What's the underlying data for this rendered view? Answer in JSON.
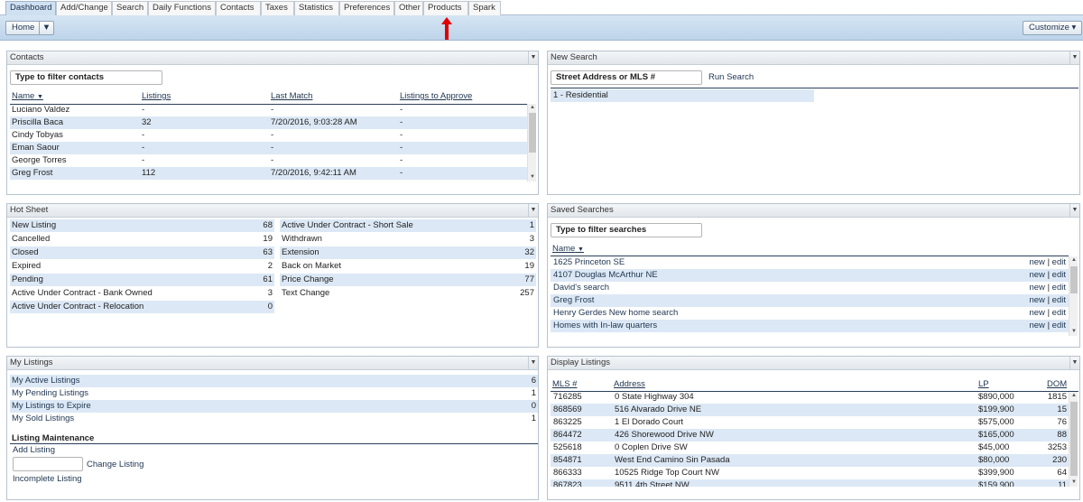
{
  "tabs": [
    "Dashboard",
    "Add/Change",
    "Search",
    "Daily Functions",
    "Contacts",
    "Taxes",
    "Statistics",
    "Preferences",
    "Other",
    "Products",
    "Spark"
  ],
  "active_tab": "Dashboard",
  "toolbar": {
    "home_label": "Home",
    "home_dropdown_icon": "chevron-down-icon",
    "customize_label": "Customize"
  },
  "contacts": {
    "title": "Contacts",
    "filter_placeholder": "Type to filter contacts",
    "headers": {
      "name": "Name",
      "listings": "Listings",
      "last_match": "Last Match",
      "to_approve": "Listings to Approve"
    },
    "rows": [
      {
        "name": "Luciano Valdez",
        "listings": "-",
        "last_match": "-",
        "to_approve": "-"
      },
      {
        "name": "Priscilla Baca",
        "listings": "32",
        "last_match": "7/20/2016, 9:03:28 AM",
        "to_approve": "-"
      },
      {
        "name": "Cindy Tobyas",
        "listings": "-",
        "last_match": "-",
        "to_approve": "-"
      },
      {
        "name": "Eman Saour",
        "listings": "-",
        "last_match": "-",
        "to_approve": "-"
      },
      {
        "name": "George Torres",
        "listings": "-",
        "last_match": "-",
        "to_approve": "-"
      },
      {
        "name": "Greg Frost",
        "listings": "112",
        "last_match": "7/20/2016, 9:42:11 AM",
        "to_approve": "-"
      }
    ]
  },
  "new_search": {
    "title": "New Search",
    "input_placeholder": "Street Address or MLS #",
    "run_label": "Run Search",
    "options": [
      "1 - Residential"
    ]
  },
  "hot_sheet": {
    "title": "Hot Sheet",
    "left": [
      {
        "label": "New Listing",
        "count": "68"
      },
      {
        "label": "Cancelled",
        "count": "19"
      },
      {
        "label": "Closed",
        "count": "63"
      },
      {
        "label": "Expired",
        "count": "2"
      },
      {
        "label": "Pending",
        "count": "61"
      },
      {
        "label": "Active Under Contract - Bank Owned",
        "count": "3"
      },
      {
        "label": "Active Under Contract - Relocation",
        "count": "0"
      }
    ],
    "right": [
      {
        "label": "Active Under Contract - Short Sale",
        "count": "1"
      },
      {
        "label": "Withdrawn",
        "count": "3"
      },
      {
        "label": "Extension",
        "count": "32"
      },
      {
        "label": "Back on Market",
        "count": "19"
      },
      {
        "label": "Price Change",
        "count": "77"
      },
      {
        "label": "Text Change",
        "count": "257"
      }
    ]
  },
  "saved_searches": {
    "title": "Saved Searches",
    "filter_placeholder": "Type to filter searches",
    "name_header": "Name",
    "new_label": "new",
    "sep": "|",
    "edit_label": "edit",
    "rows": [
      "1625 Princeton SE",
      "4107 Douglas McArthur NE",
      "David's search",
      "Greg Frost",
      "Henry Gerdes New home search",
      "Homes with In-law quarters"
    ]
  },
  "my_listings": {
    "title": "My Listings",
    "items": [
      {
        "label": "My Active Listings",
        "count": "6"
      },
      {
        "label": "My Pending Listings",
        "count": "1"
      },
      {
        "label": "My Listings to Expire",
        "count": "0"
      },
      {
        "label": "My Sold Listings",
        "count": "1"
      }
    ],
    "maintenance_title": "Listing Maintenance",
    "add_label": "Add Listing",
    "change_label": "Change Listing",
    "incomplete_label": "Incomplete Listing"
  },
  "display_listings": {
    "title": "Display Listings",
    "headers": {
      "mls": "MLS #",
      "address": "Address",
      "lp": "LP",
      "dom": "DOM"
    },
    "rows": [
      {
        "mls": "716285",
        "address": "0 State Highway 304",
        "lp": "$890,000",
        "dom": "1815"
      },
      {
        "mls": "868569",
        "address": "516 Alvarado Drive NE",
        "lp": "$199,900",
        "dom": "15"
      },
      {
        "mls": "863225",
        "address": "1 El Dorado Court",
        "lp": "$575,000",
        "dom": "76"
      },
      {
        "mls": "864472",
        "address": "426 Shorewood Drive NW",
        "lp": "$165,000",
        "dom": "88"
      },
      {
        "mls": "525618",
        "address": "0 Coplen Drive SW",
        "lp": "$45,000",
        "dom": "3253"
      },
      {
        "mls": "854871",
        "address": "West End Camino Sin Pasada",
        "lp": "$80,000",
        "dom": "230"
      },
      {
        "mls": "866333",
        "address": "10525 Ridge Top Court NW",
        "lp": "$399,900",
        "dom": "64"
      },
      {
        "mls": "867823",
        "address": "9511 4th Street NW",
        "lp": "$159,900",
        "dom": "11"
      }
    ]
  },
  "colors": {
    "accent": "#dce8f5",
    "toolbar": "#c9dcef",
    "arrow": "#e00000"
  }
}
